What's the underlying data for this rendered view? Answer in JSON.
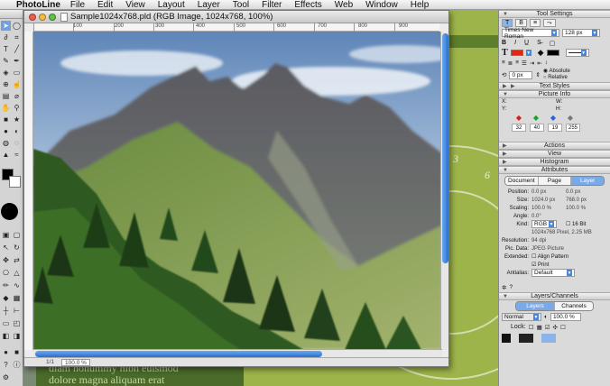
{
  "menubar": {
    "app_name": "PhotoLine",
    "items": [
      "File",
      "Edit",
      "View",
      "Layout",
      "Layer",
      "Tool",
      "Filter",
      "Effects",
      "Web",
      "Window",
      "Help"
    ]
  },
  "background_document": {
    "lorem_line1": "diam nonummy nibh euismod",
    "lorem_line2": "dolore magna aliquam erat",
    "numbers": [
      "3",
      "6"
    ]
  },
  "window": {
    "title": "Sample1024x768.pld (RGB Image, 1024x768, 100%)",
    "ruler_labels": [
      "100",
      "200",
      "300",
      "400",
      "500",
      "600",
      "700",
      "800",
      "900"
    ],
    "status_page": "1/1",
    "zoom": "100.0 %"
  },
  "panels": {
    "tool_settings": {
      "title": "Tool Settings",
      "text_tool_label": "T",
      "button_b": "B",
      "font": "Times New Roman",
      "size": "128 px",
      "bold": "B",
      "italic": "I",
      "text_color": "#e02a10",
      "secondary_color": "#000000",
      "angle": "0 px",
      "absolute": "Absolute",
      "relative": "Relative"
    },
    "text_styles": {
      "title": "Text Styles"
    },
    "picture_info": {
      "title": "Picture Info",
      "x_label": "X:",
      "y_label": "Y:",
      "w_label": "W:",
      "h_label": "H:",
      "values": [
        "32",
        "40",
        "19",
        "255"
      ],
      "color_values": [
        "#d81c1c",
        "#17a22a",
        "#2a5fe0",
        "#cfcfcf"
      ]
    },
    "actions": {
      "title": "Actions"
    },
    "view": {
      "title": "View"
    },
    "histogram": {
      "title": "Histogram"
    },
    "attributes": {
      "title": "Attributes",
      "tabs": [
        "Document",
        "Page",
        "Layer"
      ],
      "position_label": "Position:",
      "position_x": "0.0 px",
      "position_y": "0.0 px",
      "size_label": "Size:",
      "size_x": "1024.0 px",
      "size_y": "768.0 px",
      "scaling_label": "Scaling:",
      "scaling_x": "100.0 %",
      "scaling_y": "100.0 %",
      "angle_label": "Angle:",
      "angle_value": "0.0°",
      "kind_label": "Kind:",
      "kind_value": "RGB",
      "bit16": "16 Bit",
      "pixel_info": "1024x768 Pixel, 2.25 MB",
      "resolution_label": "Resolution:",
      "resolution_value": "94 dpi",
      "picdata_label": "Pic. Data:",
      "picdata_value": "JPEG Picture",
      "extended_label": "Extended:",
      "align_pattern": "Align Pattern",
      "print": "Print",
      "antialias_label": "Antialias:",
      "antialias_value": "Default"
    },
    "layers": {
      "title": "Layers/Channels",
      "tabs": [
        "Layers",
        "Channels"
      ],
      "blend_mode": "Normal",
      "opacity": "100.0 %",
      "lock_label": "Lock:"
    }
  }
}
